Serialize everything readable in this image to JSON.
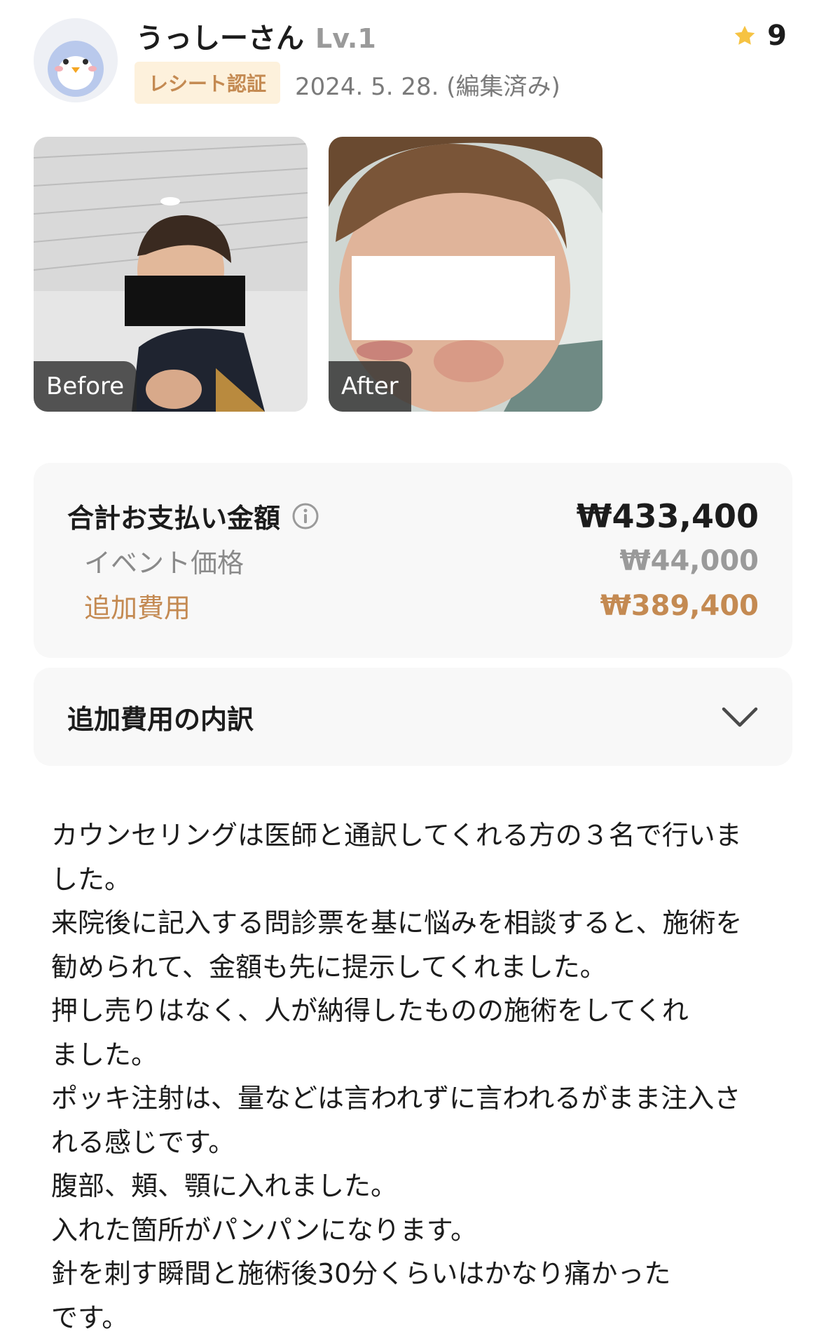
{
  "header": {
    "username": "うっしーさん",
    "level": "Lv.1",
    "badge": "レシート認証",
    "date": "2024. 5. 28. (編集済み)",
    "rating": "9",
    "avatar_icon": "penguin-avatar-icon",
    "rating_icon": "star-icon",
    "star_color": "#f6c343"
  },
  "photos": [
    {
      "label": "Before"
    },
    {
      "label": "After"
    }
  ],
  "price": {
    "total_label": "合計お支払い金額",
    "total_value": "₩433,400",
    "event_label": "イベント価格",
    "event_value": "₩44,000",
    "extra_label": "追加費用",
    "extra_value": "₩389,400",
    "accent_color": "#c48a52"
  },
  "breakdown": {
    "label": "追加費用の内訳",
    "icon": "chevron-down-icon"
  },
  "review": {
    "lines": [
      "カウンセリングは医師と通訳してくれる方の３名で行いま",
      "した。",
      "来院後に記入する問診票を基に悩みを相談すると、施術を",
      "勧められて、金額も先に提示してくれました。",
      "押し売りはなく、人が納得したものの施術をしてくれ",
      "ました。",
      "ポッキ注射は、量などは言われずに言われるがまま注入さ",
      "れる感じです。",
      "腹部、頬、顎に入れました。",
      "入れた箇所がパンパンになります。",
      "針を刺す瞬間と施術後30分くらいはかなり痛かった",
      "です。"
    ]
  }
}
